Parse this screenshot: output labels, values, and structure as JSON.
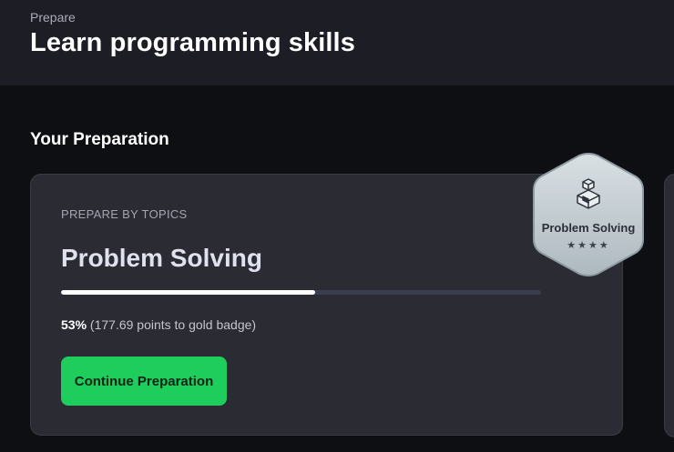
{
  "header": {
    "breadcrumb": "Prepare",
    "title": "Learn programming skills"
  },
  "section": {
    "title": "Your Preparation"
  },
  "card": {
    "eyebrow": "PREPARE BY TOPICS",
    "topic": "Problem Solving",
    "progress_percent": 53,
    "progress_percent_label": "53%",
    "progress_detail": "(177.69 points to gold badge)",
    "button_label": "Continue Preparation"
  },
  "badge": {
    "label": "Problem Solving",
    "stars": "★★★★",
    "star_count": 4
  },
  "colors": {
    "accent": "#1ecd5b",
    "header_bg": "#1c1d25",
    "page_bg": "#0e0f12",
    "card_bg": "#2a2b33",
    "progress_fill": "#ffffff",
    "progress_track": "#3b3e4e"
  }
}
